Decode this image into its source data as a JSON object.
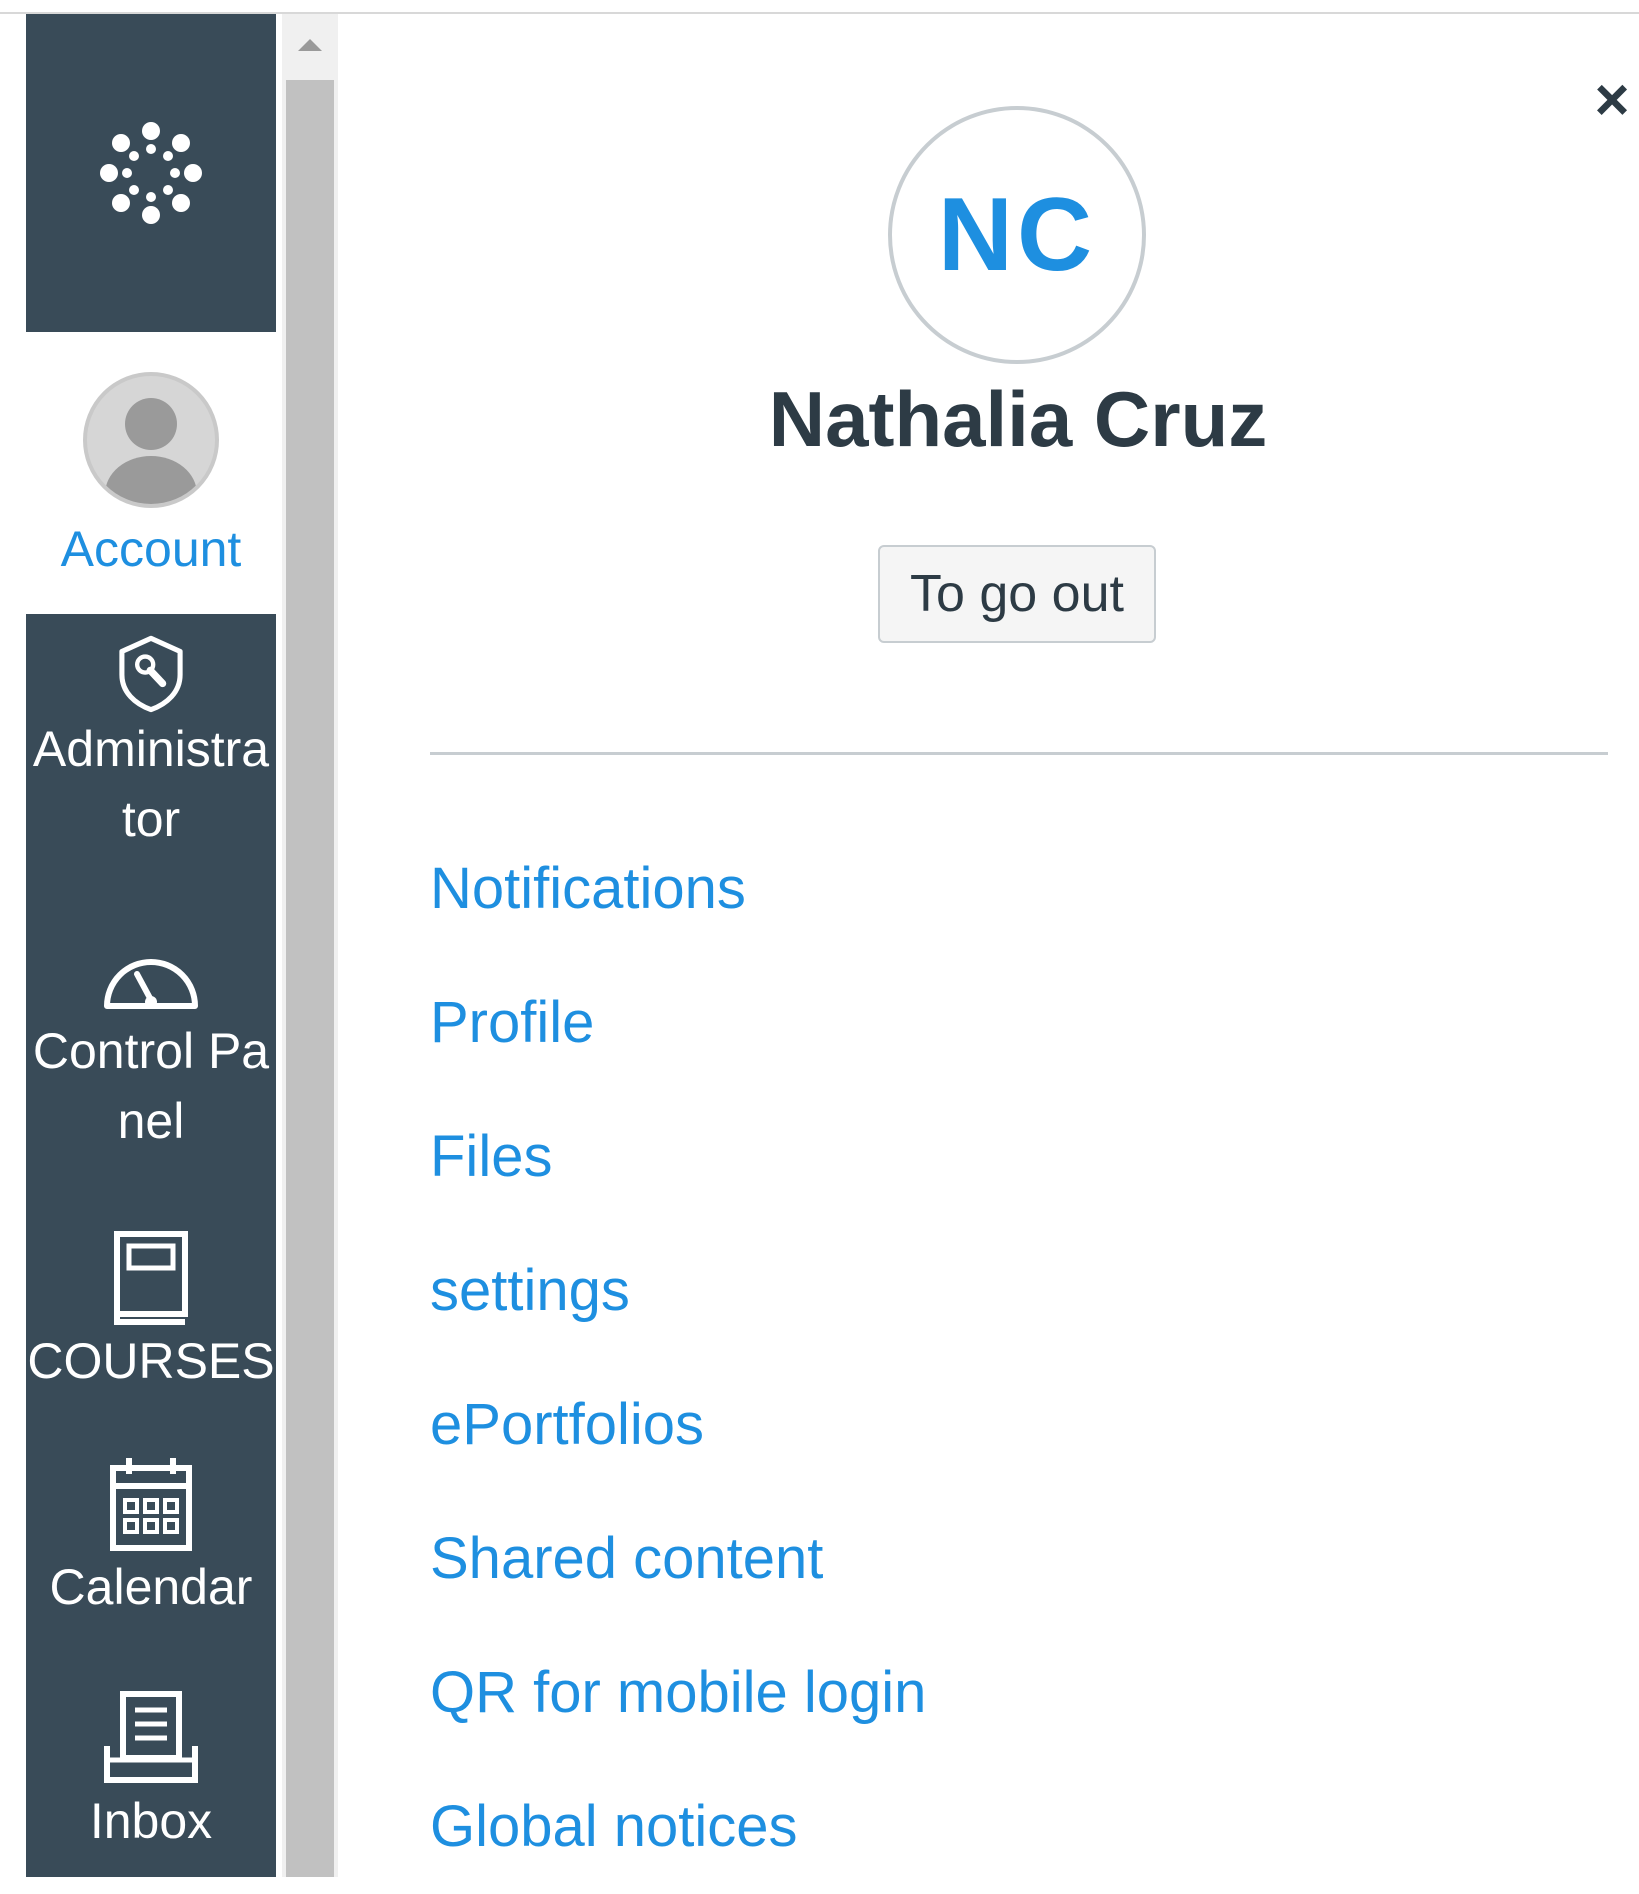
{
  "sidebar": {
    "logo": {
      "icon": "canvas-logo-icon"
    },
    "items": [
      {
        "label": "Account",
        "icon": "user-avatar-icon",
        "active": true
      },
      {
        "label": "Administrator",
        "icon": "shield-wrench-icon"
      },
      {
        "label": "Control Panel",
        "icon": "speedometer-icon"
      },
      {
        "label": "COURSES",
        "icon": "book-icon"
      },
      {
        "label": "Calendar",
        "icon": "calendar-icon"
      },
      {
        "label": "Inbox",
        "icon": "inbox-icon"
      }
    ]
  },
  "tray": {
    "close_label": "×",
    "avatar_initials": "NC",
    "user_name": "Nathalia Cruz",
    "logout_label": "To go out",
    "links": [
      "Notifications",
      "Profile",
      "Files",
      "settings",
      "ePortfolios",
      "Shared content",
      "QR for mobile login",
      "Global notices"
    ]
  },
  "colors": {
    "sidebar_bg": "#394b58",
    "link": "#1e8fe0",
    "text_dark": "#2d3b45",
    "border": "#c7cdd1"
  }
}
